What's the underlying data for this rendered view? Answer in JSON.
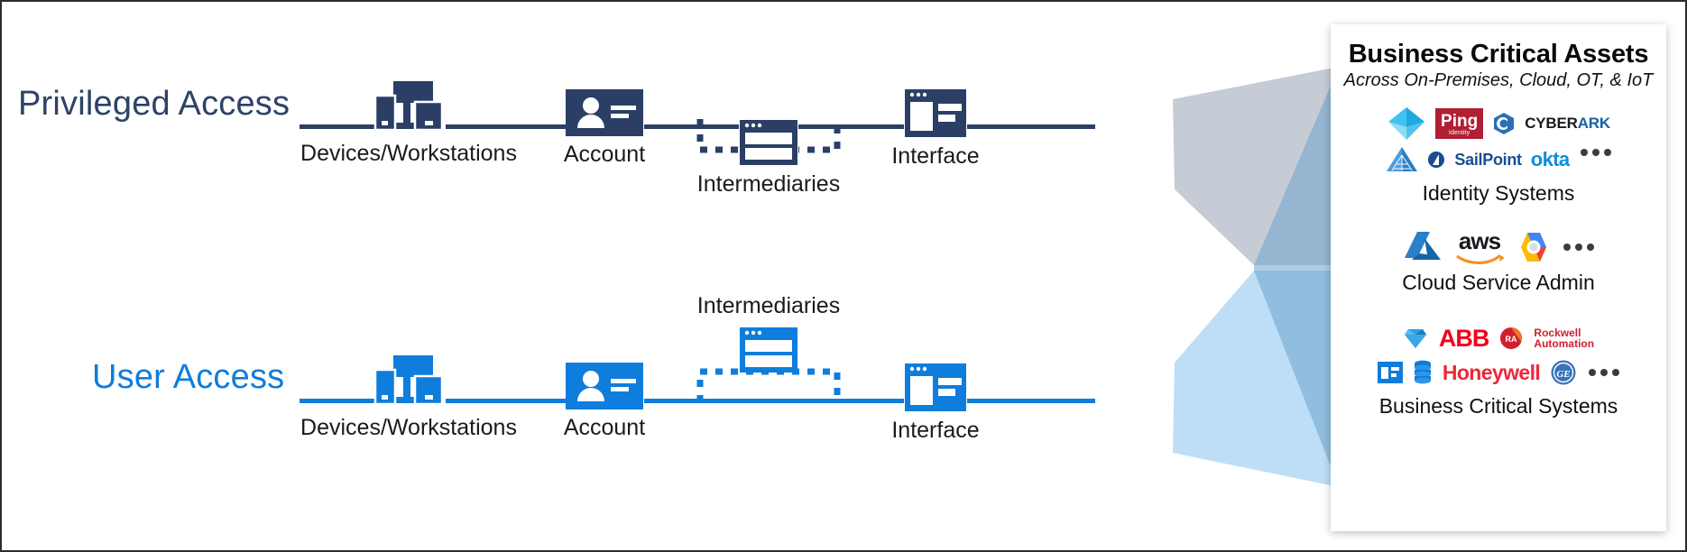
{
  "diagram": {
    "rows": [
      {
        "id": "privileged",
        "label": "Privileged Access",
        "color": "#2d4268",
        "nodes": [
          {
            "name": "devices",
            "caption": "Devices/Workstations",
            "icon": "devices-workstations-icon"
          },
          {
            "name": "account",
            "caption": "Account",
            "icon": "account-badge-icon"
          },
          {
            "name": "intermediaries",
            "caption": "Intermediaries",
            "icon": "intermediaries-window-icon"
          },
          {
            "name": "interface",
            "caption": "Interface",
            "icon": "interface-window-icon"
          }
        ]
      },
      {
        "id": "user",
        "label": "User Access",
        "color": "#0f7ddb",
        "nodes": [
          {
            "name": "devices",
            "caption": "Devices/Workstations",
            "icon": "devices-workstations-icon"
          },
          {
            "name": "account",
            "caption": "Account",
            "icon": "account-badge-icon"
          },
          {
            "name": "intermediaries",
            "caption": "Intermediaries",
            "icon": "intermediaries-window-icon"
          },
          {
            "name": "interface",
            "caption": "Interface",
            "icon": "interface-window-icon"
          }
        ]
      }
    ]
  },
  "panel": {
    "title": "Business Critical Assets",
    "subtitle": "Across On-Premises, Cloud, OT, & IoT",
    "groups": [
      {
        "id": "identity",
        "caption": "Identity Systems",
        "logos_row1": [
          "azure-ad-diamond",
          "ping-identity",
          "cyberark"
        ],
        "logos_row2": [
          "pyramid-identity",
          "sailpoint",
          "okta"
        ],
        "ping_label": "Ping",
        "ping_sublabel": "Identity",
        "cyberark_label_1": "CYBER",
        "cyberark_label_2": "ARK",
        "sailpoint_label": "SailPoint",
        "okta_label": "okta",
        "more": "..."
      },
      {
        "id": "cloud",
        "caption": "Cloud Service Admin",
        "logos_row1": [
          "azure",
          "aws",
          "google-cloud"
        ],
        "aws_label": "aws",
        "more": "..."
      },
      {
        "id": "business",
        "caption": "Business Critical Systems",
        "logos_row1": [
          "sap-diamond",
          "abb",
          "rockwell-automation"
        ],
        "logos_row2": [
          "window-app",
          "database-stack",
          "honeywell",
          "general-electric"
        ],
        "abb_label": "ABB",
        "rockwell_label_1": "Rockwell",
        "rockwell_label_2": "Automation",
        "honeywell_label": "Honeywell",
        "ge_label": "GE",
        "more": "..."
      }
    ]
  },
  "colors": {
    "dark_navy": "#2b3f66",
    "bright_blue": "#0f7ddb",
    "funnel_gray": "#c3c9d4",
    "funnel_blue": "#b9dcf5"
  }
}
